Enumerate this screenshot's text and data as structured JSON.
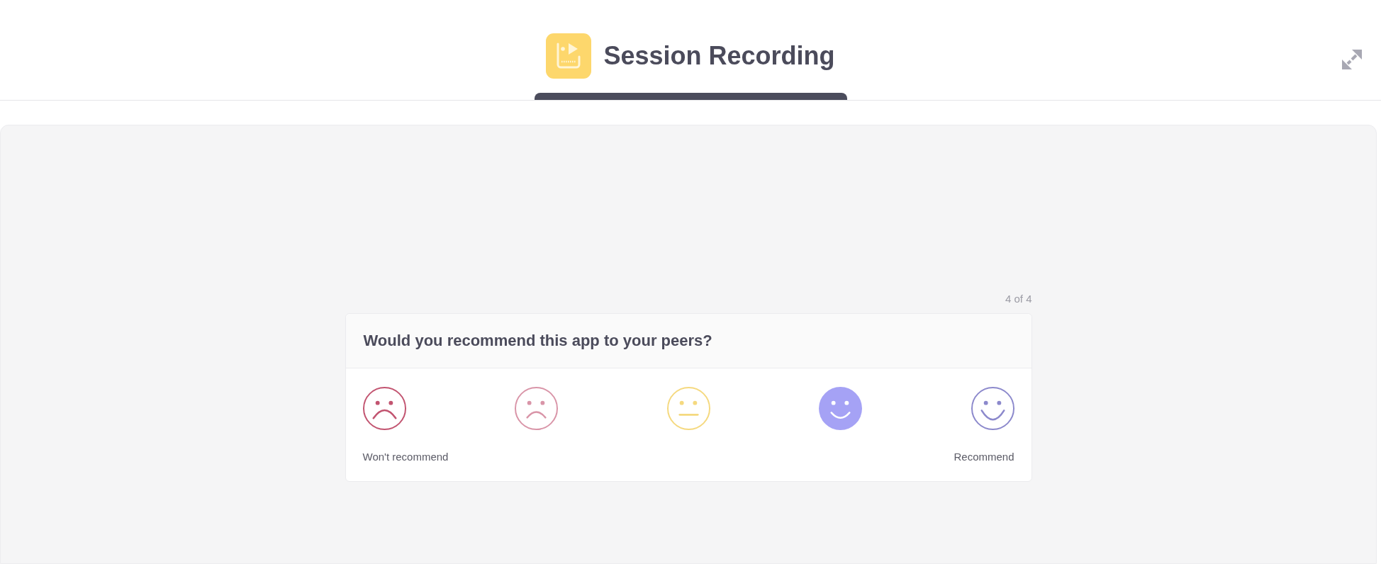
{
  "header": {
    "title": "Session Recording"
  },
  "survey": {
    "progress": "4 of 4",
    "question": "Would you recommend this app to your peers?",
    "options": [
      {
        "kind": "verysad",
        "color": "#c25470",
        "selected": false
      },
      {
        "kind": "sad",
        "color": "#d995a8",
        "selected": false
      },
      {
        "kind": "neutral",
        "color": "#f5d97f",
        "selected": false
      },
      {
        "kind": "happy",
        "color": "#a5a2f5",
        "selected": true
      },
      {
        "kind": "veryhappy",
        "color": "#8c89cc",
        "selected": false
      }
    ],
    "scale_labels": {
      "low": "Won't recommend",
      "high": "Recommend"
    }
  }
}
